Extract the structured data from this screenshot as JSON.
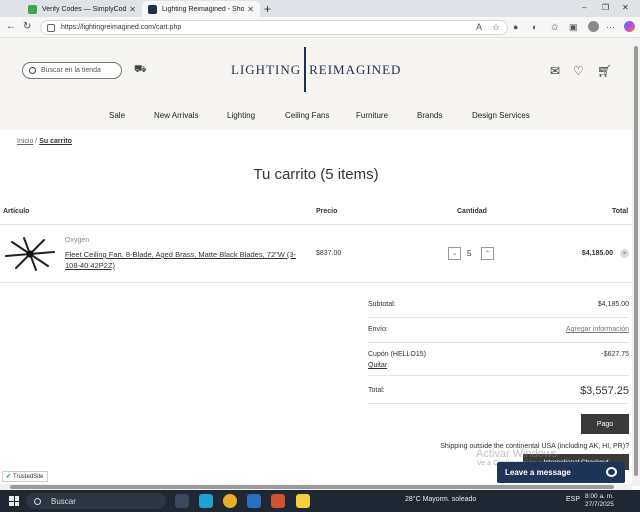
{
  "browser": {
    "tabs": [
      {
        "title": "Verify Codes — SimplyCodes",
        "active": false
      },
      {
        "title": "Lighting Reimagined - Shopping",
        "active": true
      }
    ],
    "url": "https://lightingreimagined.com/cart.php",
    "new_tab": "+",
    "window_controls": [
      "–",
      "❐",
      "✕"
    ],
    "nav": {
      "back": "←",
      "refresh": "↻"
    }
  },
  "site": {
    "search_placeholder": "Buscar en la tienda",
    "logo_left": "LIGHTING",
    "logo_right": "REIMAGINED",
    "nav_items": [
      "Sale",
      "New Arrivals",
      "Lighting",
      "Ceiling Fans",
      "Furniture",
      "Brands",
      "Design Services"
    ]
  },
  "breadcrumb": {
    "home": "Inicio",
    "separator": "/",
    "current": "Su carrito"
  },
  "cart": {
    "title": "Tu carrito (5 items)",
    "columns": {
      "item": "Artículo",
      "price": "Precio",
      "qty": "Cantidad",
      "total": "Total"
    },
    "item": {
      "brand": "Oxygen",
      "name": "Fleet Ceiling Fan, 8-Blade, Aged Brass, Matte Black Blades, 72\"W (3-108-40 42P2Z)",
      "price": "$837.00",
      "quantity": "5",
      "line_total": "$4,185.00",
      "remove": "×",
      "qty_down": "⌄",
      "qty_up": "⌃"
    },
    "summary": {
      "subtotal_label": "Subtotal:",
      "subtotal": "$4,185.00",
      "shipping_label": "Envío:",
      "shipping_link": "Agregar información",
      "coupon_label": "Cupón (HELLO15)",
      "coupon_remove": "Quitar",
      "coupon_value": "-$627.75",
      "total_label": "Total:",
      "total": "$3,557.25"
    },
    "checkout_button": "Pago",
    "shipping_note": "Shipping outside the continental USA (including AK, HI, PR)?",
    "international_button": "International Checkout"
  },
  "overlay": {
    "activate_title": "Activar Windows",
    "activate_sub": "Ve a Configuración para activar Windows.",
    "leave_message": "Leave a message",
    "trusted_site": "TrustedSite"
  },
  "taskbar": {
    "search": "Buscar",
    "weather": "28°C  Mayorm. soleado",
    "lang": "ESP",
    "time": "8:00 a. m.",
    "date": "27/7/2025"
  },
  "colors": {
    "brand_navy": "#1f2f4e",
    "button_dark": "#3a3a3a",
    "chat_navy": "#1f3557",
    "header_bg": "#f6f5f1"
  }
}
